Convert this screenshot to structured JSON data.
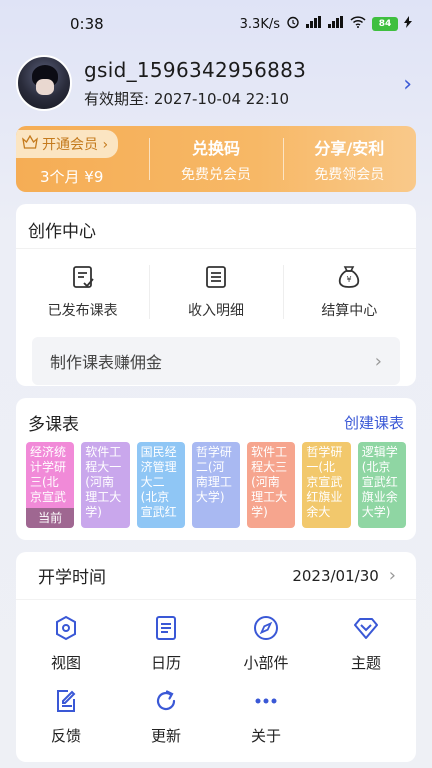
{
  "status_bar": {
    "time": "0:38",
    "net_speed": "3.3K/s",
    "battery": "84"
  },
  "profile": {
    "username": "gsid_1596342956883",
    "expiry": "有效期至: 2027-10-04 22:10"
  },
  "vip": {
    "open_label": "开通会员 ›",
    "price": "3个月 ¥9",
    "redeem_title": "兑换码",
    "redeem_sub": "免费兑会员",
    "share_title": "分享/安利",
    "share_sub": "免费领会员"
  },
  "creation": {
    "title": "创作中心",
    "items": [
      {
        "label": "已发布课表",
        "icon": "published-schedule-icon"
      },
      {
        "label": "收入明细",
        "icon": "income-list-icon"
      },
      {
        "label": "结算中心",
        "icon": "money-bag-icon"
      }
    ],
    "earn_label": "制作课表赚佣金"
  },
  "schedules": {
    "title": "多课表",
    "create_label": "创建课表",
    "current_label": "当前",
    "tiles": [
      {
        "text": "经济统计学研三(北京宣武",
        "color": "#f18ad8"
      },
      {
        "text": "软件工程大一(河南理工大学)",
        "color": "#c9a7ec"
      },
      {
        "text": "国民经济管理大二(北京宣武红",
        "color": "#8fc6f5"
      },
      {
        "text": "哲学研二(河南理工大学)",
        "color": "#a9b9f2"
      },
      {
        "text": "软件工程大三(河南理工大学)",
        "color": "#f6a58e"
      },
      {
        "text": "哲学研一(北京宣武红旗业余大",
        "color": "#f2c86c"
      },
      {
        "text": "逻辑学(北京宣武红旗业余大学)",
        "color": "#8fd6a3"
      }
    ]
  },
  "start": {
    "label": "开学时间",
    "date": "2023/01/30"
  },
  "grid": [
    {
      "label": "视图",
      "icon": "view-hexagon-icon"
    },
    {
      "label": "日历",
      "icon": "calendar-icon"
    },
    {
      "label": "小部件",
      "icon": "compass-icon"
    },
    {
      "label": "主题",
      "icon": "diamond-icon"
    },
    {
      "label": "反馈",
      "icon": "feedback-edit-icon"
    },
    {
      "label": "更新",
      "icon": "refresh-icon"
    },
    {
      "label": "关于",
      "icon": "more-dots-icon"
    }
  ],
  "colors": {
    "accent": "#3a58d6",
    "vip_orange": "#f5ad55"
  }
}
